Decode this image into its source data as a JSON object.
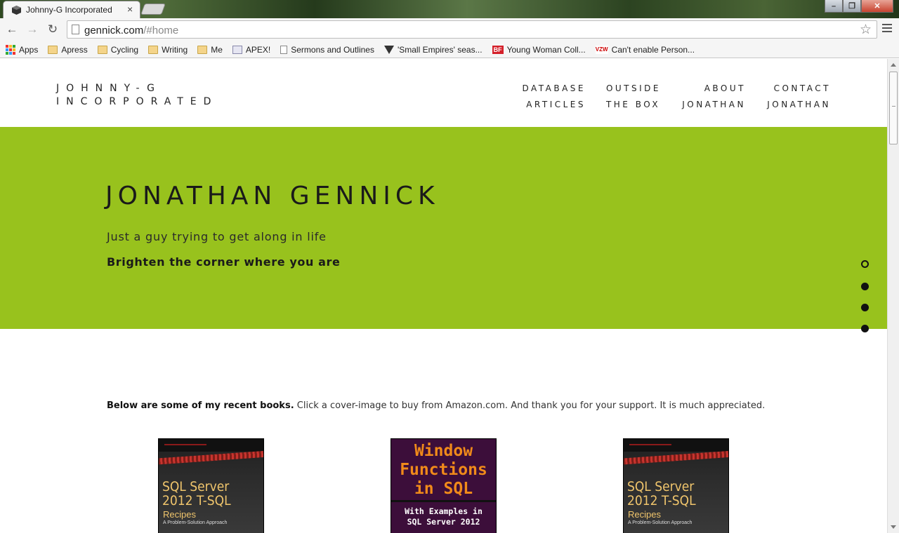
{
  "browser": {
    "tab_title": "Johnny-G Incorporated",
    "url_host": "gennick.com",
    "url_path": "/#home",
    "bookmarks": [
      {
        "label": "Apps",
        "icon": "apps-grid-icon"
      },
      {
        "label": "Apress",
        "icon": "folder-icon"
      },
      {
        "label": "Cycling",
        "icon": "folder-icon"
      },
      {
        "label": "Writing",
        "icon": "folder-icon"
      },
      {
        "label": "Me",
        "icon": "folder-icon"
      },
      {
        "label": "APEX!",
        "icon": "apex-icon"
      },
      {
        "label": "Sermons and Outlines",
        "icon": "document-icon"
      },
      {
        "label": "'Small Empires' seas...",
        "icon": "verge-icon"
      },
      {
        "label": "Young Woman Coll...",
        "icon": "bf-icon"
      },
      {
        "label": "Can't enable Person...",
        "icon": "vzw-icon"
      }
    ]
  },
  "site": {
    "logo_line1": "JOHNNY-G",
    "logo_line2": "INCORPORATED",
    "nav": [
      {
        "line1": "DATABASE",
        "line2": "ARTICLES"
      },
      {
        "line1": "OUTSIDE",
        "line2": "THE BOX"
      },
      {
        "line1": "ABOUT",
        "line2": "JONATHAN"
      },
      {
        "line1": "CONTACT",
        "line2": "JONATHAN"
      }
    ]
  },
  "hero": {
    "name": "JONATHAN GENNICK",
    "tagline": "Just a guy trying to get along in life",
    "motto": "Brighten the corner where you are",
    "accent_color": "#98c21d",
    "active_slide": 1,
    "slide_count": 4
  },
  "books": {
    "intro_bold": "Below are some of my recent books.",
    "intro_text": " Click a cover-image to buy from Amazon.com. And thank you for your support. It is much appreciated.",
    "items": [
      {
        "title_line1": "SQL Server",
        "title_line2": "2012 T-SQL",
        "title_line3": "Recipes",
        "subtitle": "A Problem-Solution Approach"
      },
      {
        "title_line1": "Window",
        "title_line2": "Functions",
        "title_line3": "in SQL",
        "sub_line1": "With Examples in",
        "sub_line2": "SQL Server 2012"
      },
      {
        "title_line1": "SQL Server",
        "title_line2": "2012 T-SQL",
        "title_line3": "Recipes",
        "subtitle": "A Problem-Solution Approach"
      }
    ]
  }
}
